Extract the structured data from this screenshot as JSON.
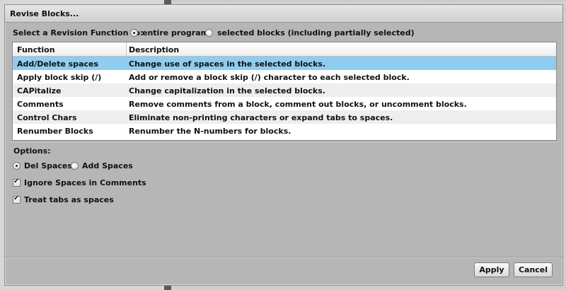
{
  "dialog": {
    "title": "Revise Blocks..."
  },
  "revision": {
    "prompt": "Select a Revision Function to:",
    "options": [
      {
        "label": "entire program",
        "selected": true
      },
      {
        "label": "selected blocks (including partially selected)",
        "selected": false
      }
    ]
  },
  "table": {
    "headers": [
      "Function",
      "Description"
    ],
    "rows": [
      {
        "function": "Add/Delete spaces",
        "description": "Change use of spaces in the selected blocks.",
        "selected": true
      },
      {
        "function": "Apply block skip (/)",
        "description": "Add or remove a block skip (/) character to each selected block.",
        "selected": false
      },
      {
        "function": "CAPitalize",
        "description": "Change capitalization in the selected blocks.",
        "selected": false
      },
      {
        "function": "Comments",
        "description": "Remove comments from a block, comment out blocks, or uncomment blocks.",
        "selected": false
      },
      {
        "function": "Control Chars",
        "description": "Eliminate non-printing characters or expand tabs to spaces.",
        "selected": false
      },
      {
        "function": "Renumber Blocks",
        "description": "Renumber the N-numbers for blocks.",
        "selected": false
      }
    ]
  },
  "options": {
    "label": "Options:",
    "space_mode": [
      {
        "label": "Del Spaces",
        "selected": true
      },
      {
        "label": "Add Spaces",
        "selected": false
      }
    ],
    "checkboxes": [
      {
        "label": "Ignore Spaces in Comments",
        "checked": true
      },
      {
        "label": "Treat tabs as spaces",
        "checked": true
      }
    ]
  },
  "buttons": {
    "apply": "Apply",
    "cancel": "Cancel"
  },
  "colors": {
    "selected_row": "#8ecdf0",
    "dialog_bg": "#b6b6b6"
  }
}
